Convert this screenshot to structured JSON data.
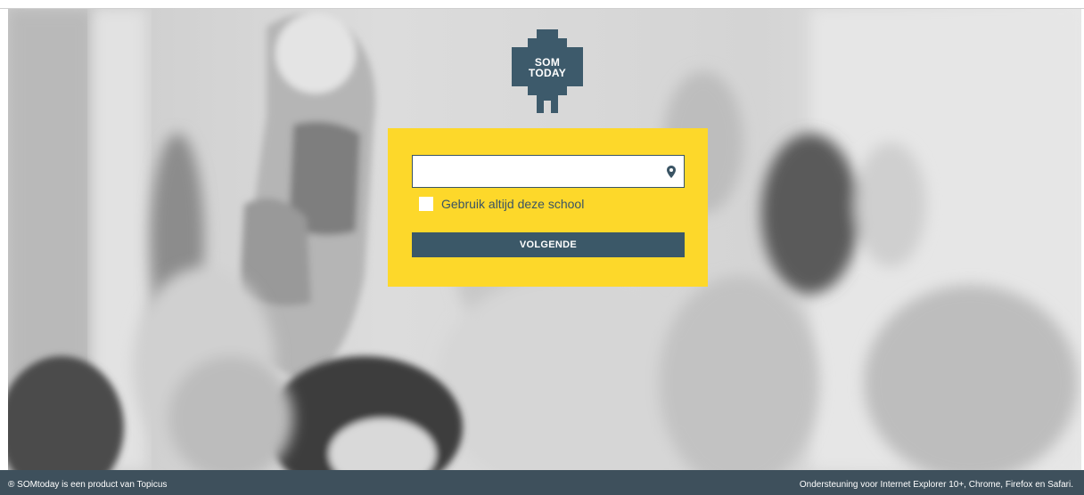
{
  "logo": {
    "line1": "SOM",
    "line2": "TODAY",
    "color": "#3d5a6b"
  },
  "login": {
    "school_input": {
      "value": "",
      "placeholder": ""
    },
    "location_icon": "map-pin-icon",
    "remember_school_label": "Gebruik altijd deze school",
    "remember_school_checked": false,
    "next_button_label": "VOLGENDE",
    "card_color": "#fdd82a",
    "button_color": "#3b5868"
  },
  "footer": {
    "left_text": "® SOMtoday is een product van Topicus",
    "right_text": "Ondersteuning voor Internet Explorer 10+, Chrome, Firefox en Safari.",
    "color": "#3e505c"
  }
}
